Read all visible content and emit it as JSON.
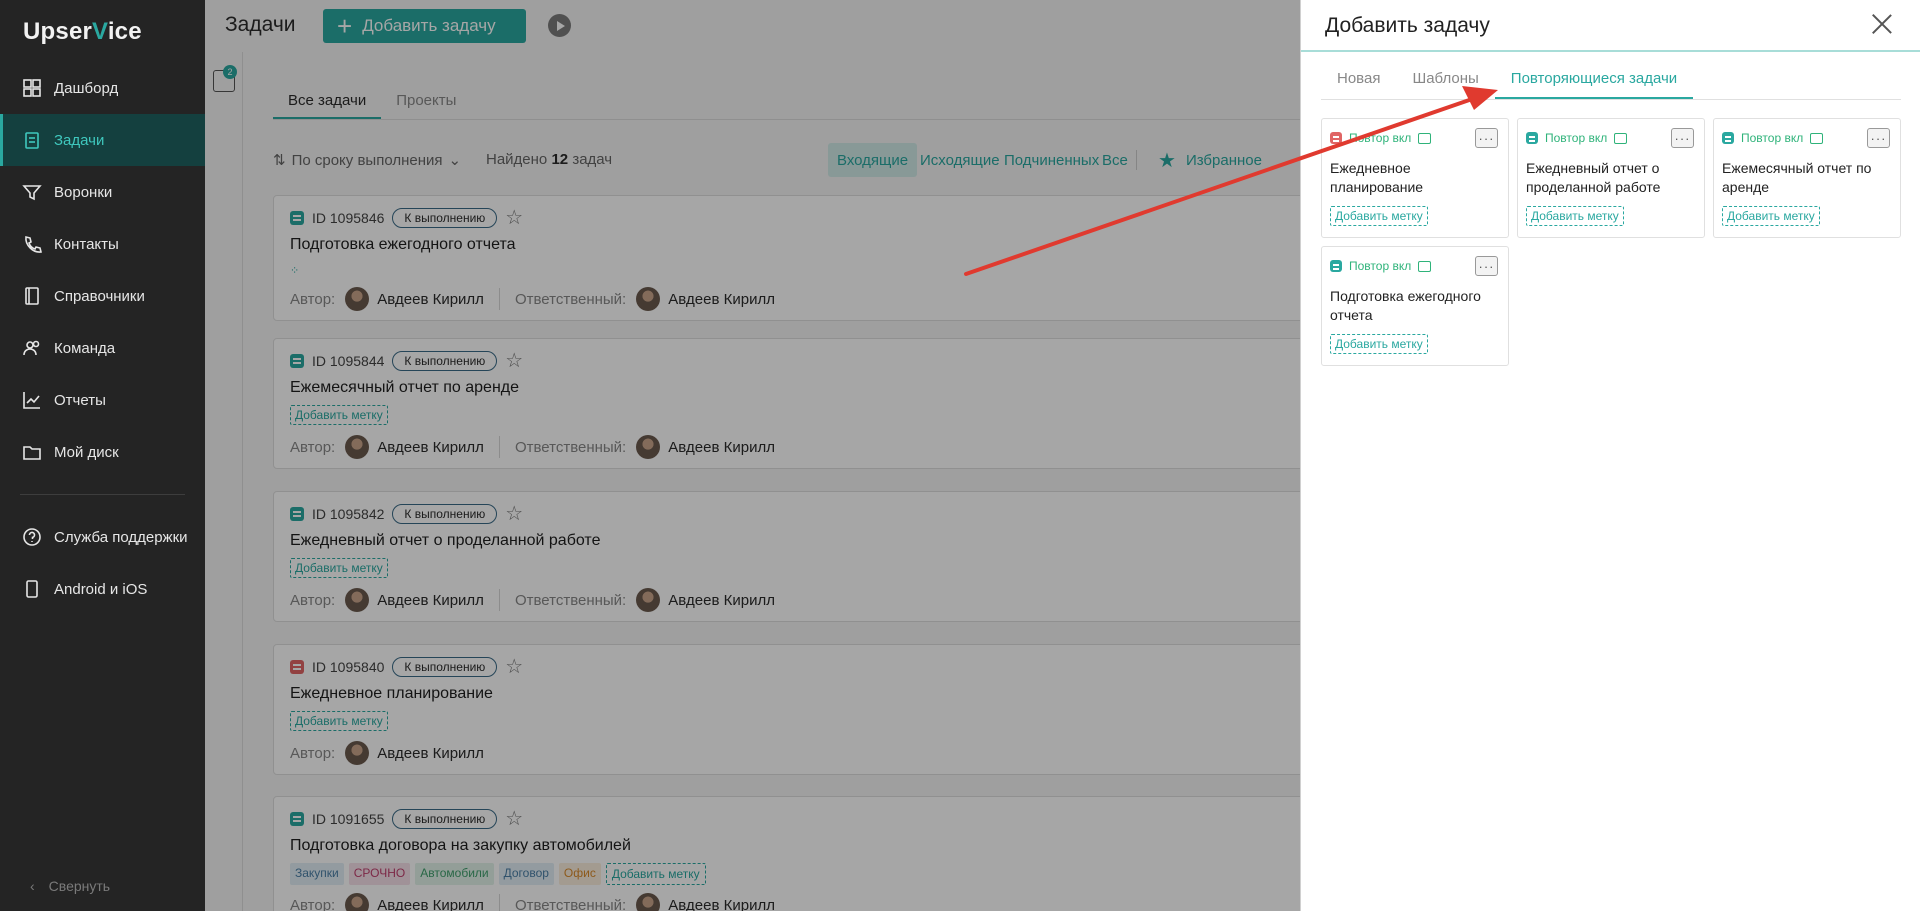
{
  "app": {
    "logo_left": "Upser",
    "logo_v": "V",
    "logo_right": "ice"
  },
  "sidebar": {
    "items": [
      {
        "label": "Дашборд",
        "icon": "dashboard-icon"
      },
      {
        "label": "Задачи",
        "icon": "tasks-icon",
        "active": true
      },
      {
        "label": "Воронки",
        "icon": "funnel-icon"
      },
      {
        "label": "Контакты",
        "icon": "phone-icon"
      },
      {
        "label": "Справочники",
        "icon": "book-icon"
      },
      {
        "label": "Команда",
        "icon": "team-icon"
      },
      {
        "label": "Отчеты",
        "icon": "chart-icon"
      },
      {
        "label": "Мой диск",
        "icon": "folder-icon"
      }
    ],
    "bottom_items": [
      {
        "label": "Служба поддержки",
        "icon": "help-icon"
      },
      {
        "label": "Android и iOS",
        "icon": "mobile-icon"
      }
    ],
    "collapse_label": "Свернуть"
  },
  "header": {
    "title": "Задачи",
    "add_button": "Добавить задачу",
    "filter_count": "2"
  },
  "tabs": {
    "all": "Все задачи",
    "projects": "Проекты"
  },
  "toolbar": {
    "sort_label": "По сроку выполнения",
    "found_prefix": "Найдено",
    "found_count": "12",
    "found_suffix": "задач",
    "segments": [
      "Входящие",
      "Исходящие",
      "Подчиненных",
      "Все"
    ],
    "favorites": "Избранное"
  },
  "tasks": [
    {
      "id": "ID 1095846",
      "status": "К выполнению",
      "title": "Подготовка ежегодного отчета",
      "author_label": "Автор:",
      "author": "Авдеев Кирилл",
      "resp_label": "Ответственный:",
      "resp": "Авдеев Кирилл"
    },
    {
      "id": "ID 1095844",
      "status": "К выполнению",
      "title": "Ежемесячный отчет по аренде",
      "add_tag": "Добавить метку",
      "author_label": "Автор:",
      "author": "Авдеев Кирилл",
      "resp_label": "Ответственный:",
      "resp": "Авдеев Кирилл"
    },
    {
      "id": "ID 1095842",
      "status": "К выполнению",
      "title": "Ежедневный отчет о проделанной работе",
      "add_tag": "Добавить метку",
      "author_label": "Автор:",
      "author": "Авдеев Кирилл",
      "resp_label": "Ответственный:",
      "resp": "Авдеев Кирилл"
    },
    {
      "id": "ID 1095840",
      "status": "К выполнению",
      "title": "Ежедневное планирование",
      "add_tag": "Добавить метку",
      "author_label": "Автор:",
      "author": "Авдеев Кирилл"
    },
    {
      "id": "ID 1091655",
      "status": "К выполнению",
      "title": "Подготовка договора на закупку автомобилей",
      "tags": [
        "Закупки",
        "СРОЧНО",
        "Автомобили",
        "Договор",
        "Офис"
      ],
      "add_tag": "Добавить метку",
      "author_label": "Автор:",
      "author": "Авдеев Кирилл",
      "resp_label": "Ответственный:",
      "resp": "Авдеев Кирилл"
    }
  ],
  "panel": {
    "title": "Добавить задачу",
    "tabs": [
      "Новая",
      "Шаблоны",
      "Повторяющиеся задачи"
    ],
    "cards": [
      {
        "repeat": "Повтор вкл",
        "title": "Ежедневное планирование",
        "add_tag": "Добавить метку"
      },
      {
        "repeat": "Повтор вкл",
        "title": "Ежедневный отчет о проделанной работе",
        "add_tag": "Добавить метку"
      },
      {
        "repeat": "Повтор вкл",
        "title": "Ежемесячный отчет по аренде",
        "add_tag": "Добавить метку"
      },
      {
        "repeat": "Повтор вкл",
        "title": "Подготовка ежегодного отчета",
        "add_tag": "Добавить метку"
      }
    ],
    "more_glyph": "···"
  },
  "colors": {
    "accent": "#2aa8a0",
    "sidebar_bg": "#242424",
    "arrow": "#e03a2f"
  }
}
